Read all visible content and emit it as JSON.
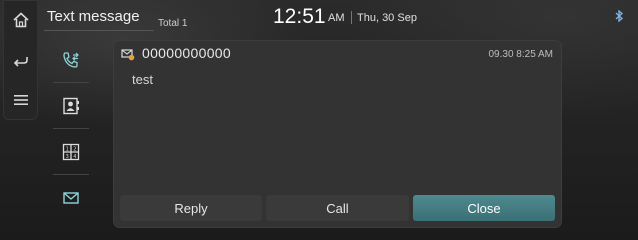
{
  "header": {
    "title": "Text message",
    "total": "Total 1",
    "time": "12:51",
    "ampm": "AM",
    "date": "Thu, 30 Sep"
  },
  "rail": {
    "icons": [
      "home-icon",
      "back-icon",
      "menu-icon"
    ]
  },
  "side_menu": {
    "icons": [
      "call-history-icon",
      "contacts-icon",
      "keypad-icon",
      "messages-icon"
    ],
    "accent": "#8fd4d9"
  },
  "message": {
    "sender": "00000000000",
    "timestamp": "09.30 8:25 AM",
    "body": "test"
  },
  "actions": {
    "reply": "Reply",
    "call": "Call",
    "close": "Close",
    "close_color": "#4a858a"
  }
}
